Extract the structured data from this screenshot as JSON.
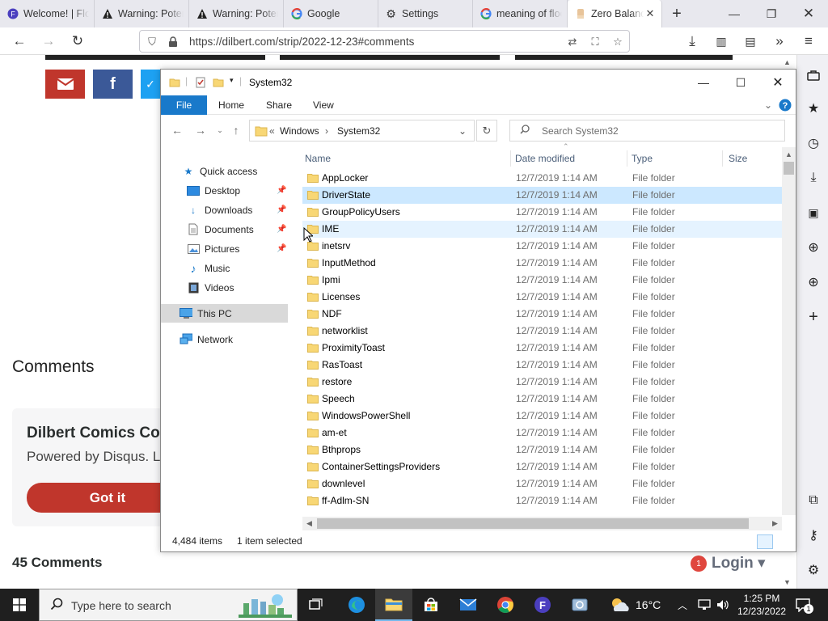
{
  "browser": {
    "tabs": [
      {
        "label": "Welcome! | Floorplanner",
        "icon": "floorplanner-icon"
      },
      {
        "label": "Warning: Potential Security Risk",
        "icon": "warning-icon"
      },
      {
        "label": "Warning: Potential Security Risk",
        "icon": "warning-icon"
      },
      {
        "label": "Google",
        "icon": "google-icon"
      },
      {
        "label": "Settings",
        "icon": "gear-icon"
      },
      {
        "label": "meaning of floor",
        "icon": "google-icon"
      },
      {
        "label": "Zero Balance",
        "icon": "dilbert-icon"
      }
    ],
    "url": "https://dilbert.com/strip/2022-12-23#comments"
  },
  "page": {
    "comments_heading": "Comments",
    "disqus_title": "Dilbert Comics Comments",
    "disqus_sub": "Powered by Disqus. Learn more",
    "got_it": "Got it",
    "comment_count": "45 Comments",
    "login": "Login ▾",
    "notif_count": "1",
    "colors": {
      "email": "#c0362c",
      "facebook": "#3b5998",
      "twitter": "#1da1f2"
    }
  },
  "explorer": {
    "title": "System32",
    "ribbon": [
      "File",
      "Home",
      "Share",
      "View"
    ],
    "address": {
      "prefix": "«",
      "seg1": "Windows",
      "sep": "›",
      "seg2": "System32"
    },
    "search_placeholder": "Search System32",
    "nav": {
      "quick_access": "Quick access",
      "desktop": "Desktop",
      "downloads": "Downloads",
      "documents": "Documents",
      "pictures": "Pictures",
      "music": "Music",
      "videos": "Videos",
      "this_pc": "This PC",
      "network": "Network"
    },
    "columns": {
      "name": "Name",
      "date": "Date modified",
      "type": "Type",
      "size": "Size"
    },
    "rows": [
      {
        "name": "AppLocker",
        "date": "12/7/2019 1:14 AM",
        "type": "File folder"
      },
      {
        "name": "DriverState",
        "date": "12/7/2019 1:14 AM",
        "type": "File folder"
      },
      {
        "name": "GroupPolicyUsers",
        "date": "12/7/2019 1:14 AM",
        "type": "File folder"
      },
      {
        "name": "IME",
        "date": "12/7/2019 1:14 AM",
        "type": "File folder"
      },
      {
        "name": "inetsrv",
        "date": "12/7/2019 1:14 AM",
        "type": "File folder"
      },
      {
        "name": "InputMethod",
        "date": "12/7/2019 1:14 AM",
        "type": "File folder"
      },
      {
        "name": "Ipmi",
        "date": "12/7/2019 1:14 AM",
        "type": "File folder"
      },
      {
        "name": "Licenses",
        "date": "12/7/2019 1:14 AM",
        "type": "File folder"
      },
      {
        "name": "NDF",
        "date": "12/7/2019 1:14 AM",
        "type": "File folder"
      },
      {
        "name": "networklist",
        "date": "12/7/2019 1:14 AM",
        "type": "File folder"
      },
      {
        "name": "ProximityToast",
        "date": "12/7/2019 1:14 AM",
        "type": "File folder"
      },
      {
        "name": "RasToast",
        "date": "12/7/2019 1:14 AM",
        "type": "File folder"
      },
      {
        "name": "restore",
        "date": "12/7/2019 1:14 AM",
        "type": "File folder"
      },
      {
        "name": "Speech",
        "date": "12/7/2019 1:14 AM",
        "type": "File folder"
      },
      {
        "name": "WindowsPowerShell",
        "date": "12/7/2019 1:14 AM",
        "type": "File folder"
      },
      {
        "name": "am-et",
        "date": "12/7/2019 1:14 AM",
        "type": "File folder"
      },
      {
        "name": "Bthprops",
        "date": "12/7/2019 1:14 AM",
        "type": "File folder"
      },
      {
        "name": "ContainerSettingsProviders",
        "date": "12/7/2019 1:14 AM",
        "type": "File folder"
      },
      {
        "name": "downlevel",
        "date": "12/7/2019 1:14 AM",
        "type": "File folder"
      },
      {
        "name": "ff-Adlm-SN",
        "date": "12/7/2019 1:14 AM",
        "type": "File folder"
      }
    ],
    "status": {
      "items": "4,484 items",
      "selected": "1 item selected"
    }
  },
  "taskbar": {
    "search_placeholder": "Type here to search",
    "weather": "16°C",
    "time": "1:25 PM",
    "date": "12/23/2022",
    "notification_count": "1"
  }
}
